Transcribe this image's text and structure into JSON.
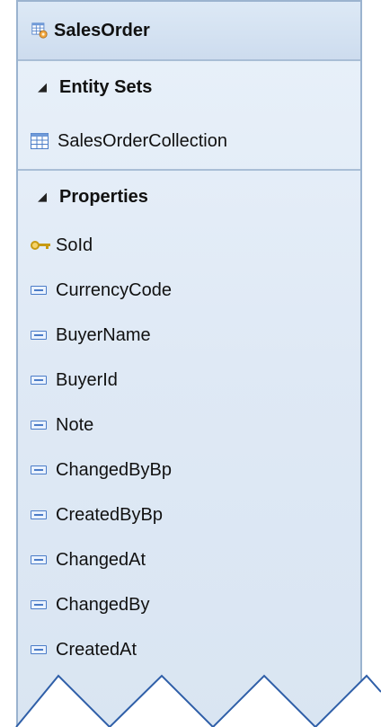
{
  "entity": {
    "title": "SalesOrder",
    "icon": "entity-type-icon"
  },
  "entity_sets": {
    "label": "Entity Sets",
    "items": [
      {
        "label": "SalesOrderCollection",
        "icon": "entity-set-icon"
      }
    ]
  },
  "properties": {
    "label": "Properties",
    "items": [
      {
        "label": "SoId",
        "icon": "key-icon"
      },
      {
        "label": "CurrencyCode",
        "icon": "property-icon"
      },
      {
        "label": "BuyerName",
        "icon": "property-icon"
      },
      {
        "label": "BuyerId",
        "icon": "property-icon"
      },
      {
        "label": "Note",
        "icon": "property-icon"
      },
      {
        "label": "ChangedByBp",
        "icon": "property-icon"
      },
      {
        "label": "CreatedByBp",
        "icon": "property-icon"
      },
      {
        "label": "ChangedAt",
        "icon": "property-icon"
      },
      {
        "label": "ChangedBy",
        "icon": "property-icon"
      },
      {
        "label": "CreatedAt",
        "icon": "property-icon"
      }
    ]
  },
  "colors": {
    "border": "#9bb3cf",
    "divider": "#a9bed6",
    "background": "#dfe9f5",
    "icon_blue": "#4b7cc7",
    "zigzag": "#2f5fa8"
  }
}
